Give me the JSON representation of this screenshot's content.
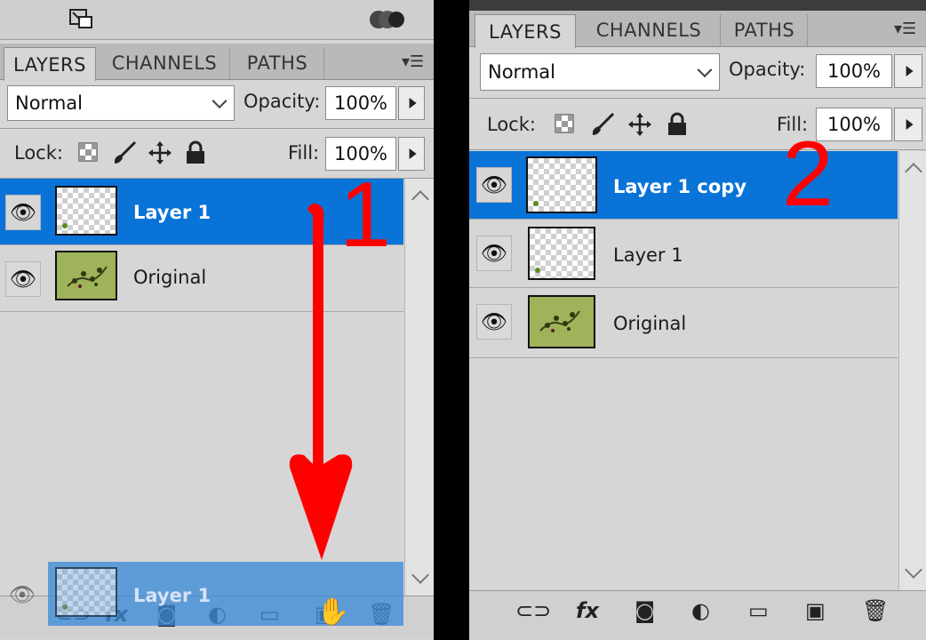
{
  "left_panel": {
    "tabs": [
      "LAYERS",
      "CHANNELS",
      "PATHS"
    ],
    "blend_mode": "Normal",
    "opacity_label": "Opacity:",
    "opacity_value": "100%",
    "lock_label": "Lock:",
    "fill_label": "Fill:",
    "fill_value": "100%",
    "layers": [
      {
        "name": "Layer 1",
        "selected": true
      },
      {
        "name": "Original",
        "selected": false
      }
    ],
    "dragged_layer": "Layer 1",
    "annotation": "1"
  },
  "right_panel": {
    "tabs": [
      "LAYERS",
      "CHANNELS",
      "PATHS"
    ],
    "blend_mode": "Normal",
    "opacity_label": "Opacity:",
    "opacity_value": "100%",
    "lock_label": "Lock:",
    "fill_label": "Fill:",
    "fill_value": "100%",
    "layers": [
      {
        "name": "Layer 1 copy",
        "selected": true
      },
      {
        "name": "Layer 1",
        "selected": false
      },
      {
        "name": "Original",
        "selected": false
      }
    ],
    "annotation": "2"
  },
  "icons": {
    "eye": "eye-icon",
    "lock_transparent": "checker-icon",
    "lock_brush": "brush-icon",
    "lock_move": "move-icon",
    "lock_all": "padlock-icon",
    "footer": [
      "link-icon",
      "fx-icon",
      "mask-icon",
      "adjustment-icon",
      "folder-icon",
      "new-layer-icon",
      "trash-icon"
    ]
  },
  "colors": {
    "selection": "#0a73d8",
    "annotation": "#ff0000",
    "panel": "#d6d6d6"
  }
}
